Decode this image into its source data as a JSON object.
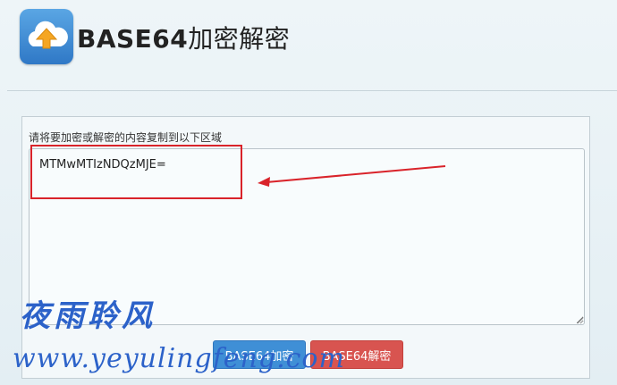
{
  "header": {
    "title_bold": "BASE64",
    "title_rest": "加密解密",
    "logo_icon": "cloud-upload-icon"
  },
  "form": {
    "label": "请将要加密或解密的内容复制到以下区域",
    "input_value": "MTMwMTIzNDQzMJE=",
    "encode_label": "BASE64加密",
    "decode_label": "BASE64解密"
  },
  "annotation": {
    "box_color": "#d9232a",
    "arrow_icon": "red-arrow-icon"
  },
  "watermark": {
    "name": "夜雨聆风",
    "url": "www.yeyulingfeng.com"
  },
  "colors": {
    "encode_button": "#3f8fd6",
    "decode_button": "#d85450",
    "watermark": "#2c62c9"
  }
}
